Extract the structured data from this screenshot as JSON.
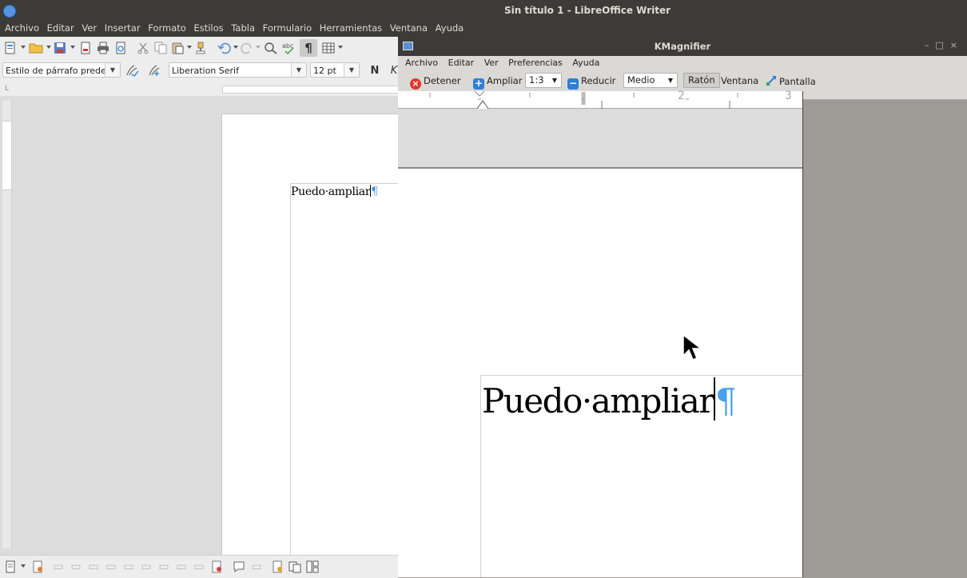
{
  "writer": {
    "window_title": "Sin título 1 - LibreOffice Writer",
    "menu": [
      "Archivo",
      "Editar",
      "Ver",
      "Insertar",
      "Formato",
      "Estilos",
      "Tabla",
      "Formulario",
      "Herramientas",
      "Ventana",
      "Ayuda"
    ],
    "paragraph_style": "Estilo de párrafo predet",
    "font_name": "Liberation Serif",
    "font_size": "12 pt",
    "bold_label": "N",
    "italic_label": "K",
    "document_text": "Puedo·ampliar",
    "pilcrow": "¶"
  },
  "kmagnifier": {
    "window_title": "KMagnifier",
    "menu": [
      "Archivo",
      "Editar",
      "Ver",
      "Preferencias",
      "Ayuda"
    ],
    "toolbar": {
      "stop_label": "Detener",
      "zoom_in_label": "Ampliar",
      "zoom_level": "1:3",
      "zoom_out_label": "Reducir",
      "refresh_speed": "Medio",
      "mode_mouse": "Ratón",
      "mode_window": "Ventana",
      "mode_screen": "Pantalla"
    },
    "ruler_labels": [
      "2",
      "3"
    ],
    "zoomed_text": "Puedo·ampliar",
    "pilcrow": "¶"
  },
  "colors": {
    "titlebar": "#3c3b37",
    "toolbar_bg": "#ededed",
    "pilcrow": "#3a8ee6",
    "stop_red": "#e0382f",
    "zoom_blue": "#2f7fd4"
  }
}
